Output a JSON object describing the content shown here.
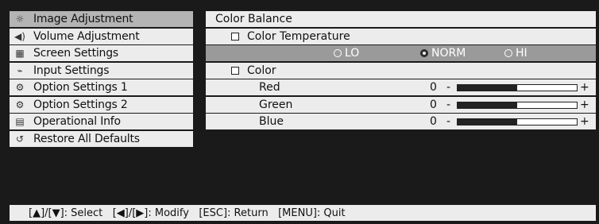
{
  "menu": {
    "items": [
      {
        "label": "Image Adjustment",
        "icon": "image-adjust-icon",
        "glyph": "☼",
        "selected": true
      },
      {
        "label": "Volume Adjustment",
        "icon": "speaker-icon",
        "glyph": "◀)",
        "selected": false
      },
      {
        "label": "Screen Settings",
        "icon": "screen-icon",
        "glyph": "▦",
        "selected": false
      },
      {
        "label": "Input Settings",
        "icon": "input-icon",
        "glyph": "⌁",
        "selected": false
      },
      {
        "label": "Option Settings 1",
        "icon": "option-icon",
        "glyph": "⚙",
        "selected": false
      },
      {
        "label": "Option Settings 2",
        "icon": "option-icon",
        "glyph": "⚙",
        "selected": false
      },
      {
        "label": "Operational Info",
        "icon": "info-icon",
        "glyph": "▤",
        "selected": false
      },
      {
        "label": "Restore All Defaults",
        "icon": "restore-icon",
        "glyph": "↺",
        "selected": false
      }
    ]
  },
  "panel": {
    "title": "Color Balance",
    "color_temperature": {
      "label": "Color Temperature",
      "options": [
        {
          "label": "LO",
          "selected": false
        },
        {
          "label": "NORM",
          "selected": true
        },
        {
          "label": "HI",
          "selected": false
        }
      ]
    },
    "color": {
      "label": "Color",
      "sliders": [
        {
          "label": "Red",
          "value": "0",
          "level": 0.5
        },
        {
          "label": "Green",
          "value": "0",
          "level": 0.5
        },
        {
          "label": "Blue",
          "value": "0",
          "level": 0.5
        }
      ],
      "minus": "-",
      "plus": "+"
    }
  },
  "footer": {
    "select": "[▲]/[▼]: Select",
    "modify": "[◀]/[▶]: Modify",
    "return": "[ESC]: Return",
    "quit": "[MENU]: Quit"
  }
}
